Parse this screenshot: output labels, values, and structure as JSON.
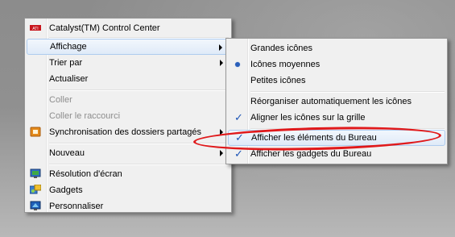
{
  "main_menu": {
    "items": [
      {
        "label": "Catalyst(TM) Control Center",
        "icon": "ati-logo-icon"
      },
      {
        "label": "Affichage",
        "submenu": true,
        "highlighted": true
      },
      {
        "label": "Trier par",
        "submenu": true
      },
      {
        "label": "Actualiser"
      },
      {
        "label": "Coller",
        "disabled": true
      },
      {
        "label": "Coller le raccourci",
        "disabled": true
      },
      {
        "label": "Synchronisation des dossiers partagés",
        "icon": "sync-folder-icon",
        "submenu": true
      },
      {
        "label": "Nouveau",
        "submenu": true
      },
      {
        "label": "Résolution d'écran",
        "icon": "display-icon"
      },
      {
        "label": "Gadgets",
        "icon": "gadgets-icon"
      },
      {
        "label": "Personnaliser",
        "icon": "personalize-icon"
      }
    ]
  },
  "sub_menu": {
    "items": [
      {
        "label": "Grandes icônes"
      },
      {
        "label": "Icônes moyennes",
        "state": "radio-selected"
      },
      {
        "label": "Petites icônes"
      },
      {
        "label": "Réorganiser automatiquement les icônes"
      },
      {
        "label": "Aligner les icônes sur la grille",
        "state": "checked"
      },
      {
        "label": "Afficher les éléments du Bureau",
        "state": "checked",
        "highlighted": true
      },
      {
        "label": "Afficher les gadgets du Bureau",
        "state": "checked"
      }
    ]
  },
  "glyphs": {
    "check": "✓"
  },
  "colors": {
    "annotation_ring": "#e0191b",
    "hover_border": "#aeccef",
    "accent": "#1d55b6"
  }
}
